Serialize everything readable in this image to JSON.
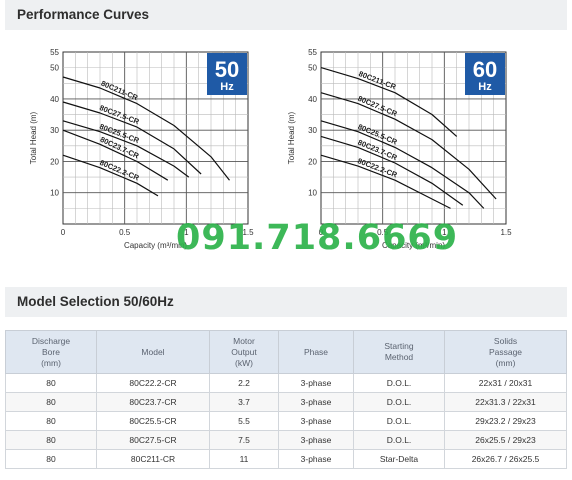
{
  "performance": {
    "title": "Performance Curves"
  },
  "selection": {
    "title": "Model Selection 50/60Hz"
  },
  "watermark": "091.718.6669",
  "chart_data": [
    {
      "type": "line",
      "badge": {
        "value": "50",
        "unit": "Hz"
      },
      "ylabel": "Total Head (m)",
      "xlabel": "Capacity (m³/min)",
      "xlim": [
        0,
        1.5
      ],
      "ylim": [
        0,
        55
      ],
      "x_ticks": [
        "0",
        "0.5",
        "1",
        "1.5"
      ],
      "y_ticks": [
        "10",
        "20",
        "30",
        "40",
        "50",
        "55"
      ],
      "grid": true,
      "series": [
        {
          "name": "80C211-CR",
          "x": [
            0,
            0.3,
            0.6,
            0.9,
            1.2,
            1.35
          ],
          "y": [
            47,
            43.5,
            38.5,
            31.5,
            21.5,
            14
          ]
        },
        {
          "name": "80C27.5-CR",
          "x": [
            0,
            0.3,
            0.6,
            0.9,
            1.12
          ],
          "y": [
            39,
            35.5,
            31,
            24,
            16
          ]
        },
        {
          "name": "80C25.5-CR",
          "x": [
            0,
            0.3,
            0.6,
            0.9,
            1.02
          ],
          "y": [
            33,
            29.5,
            25,
            18.5,
            15
          ]
        },
        {
          "name": "80C23.7-CR",
          "x": [
            0,
            0.3,
            0.6,
            0.85
          ],
          "y": [
            30,
            25.5,
            20,
            14
          ]
        },
        {
          "name": "80C22.2-CR",
          "x": [
            0,
            0.3,
            0.6,
            0.77
          ],
          "y": [
            22,
            18,
            13,
            9
          ]
        }
      ]
    },
    {
      "type": "line",
      "badge": {
        "value": "60",
        "unit": "Hz"
      },
      "ylabel": "Total Head (m)",
      "xlabel": "Capacity (m³/min)",
      "xlim": [
        0,
        1.5
      ],
      "ylim": [
        0,
        55
      ],
      "x_ticks": [
        "0",
        "0.5",
        "1",
        "1.5"
      ],
      "y_ticks": [
        "10",
        "20",
        "30",
        "40",
        "50",
        "55"
      ],
      "grid": true,
      "series": [
        {
          "name": "80C211-CR",
          "x": [
            0,
            0.3,
            0.6,
            0.9,
            1.1
          ],
          "y": [
            50,
            46.5,
            42,
            35,
            28
          ]
        },
        {
          "name": "80C27.5-CR",
          "x": [
            0,
            0.3,
            0.6,
            0.9,
            1.2,
            1.42
          ],
          "y": [
            42,
            38.5,
            33.5,
            27,
            17.5,
            8
          ]
        },
        {
          "name": "80C25.5-CR",
          "x": [
            0,
            0.3,
            0.6,
            0.9,
            1.2,
            1.32
          ],
          "y": [
            33,
            29.5,
            24.5,
            18,
            10,
            5
          ]
        },
        {
          "name": "80C23.7-CR",
          "x": [
            0,
            0.3,
            0.6,
            0.9,
            1.15
          ],
          "y": [
            28,
            24.5,
            19.5,
            13,
            6
          ]
        },
        {
          "name": "80C22.2-CR",
          "x": [
            0,
            0.3,
            0.6,
            0.9,
            1.05
          ],
          "y": [
            22,
            18.5,
            14,
            8,
            5
          ]
        }
      ]
    }
  ],
  "table": {
    "headers": [
      "Discharge\nBore\n(mm)",
      "Model",
      "Motor\nOutput\n(kW)",
      "Phase",
      "Starting\nMethod",
      "Solids\nPassage\n(mm)"
    ],
    "rows": [
      [
        "80",
        "80C22.2-CR",
        "2.2",
        "3-phase",
        "D.O.L.",
        "22x31 / 20x31"
      ],
      [
        "80",
        "80C23.7-CR",
        "3.7",
        "3-phase",
        "D.O.L.",
        "22x31.3 / 22x31"
      ],
      [
        "80",
        "80C25.5-CR",
        "5.5",
        "3-phase",
        "D.O.L.",
        "29x23.2 / 29x23"
      ],
      [
        "80",
        "80C27.5-CR",
        "7.5",
        "3-phase",
        "D.O.L.",
        "26x25.5 / 29x23"
      ],
      [
        "80",
        "80C211-CR",
        "11",
        "3-phase",
        "Star-Delta",
        "26x26.7 / 26x25.5"
      ]
    ]
  }
}
